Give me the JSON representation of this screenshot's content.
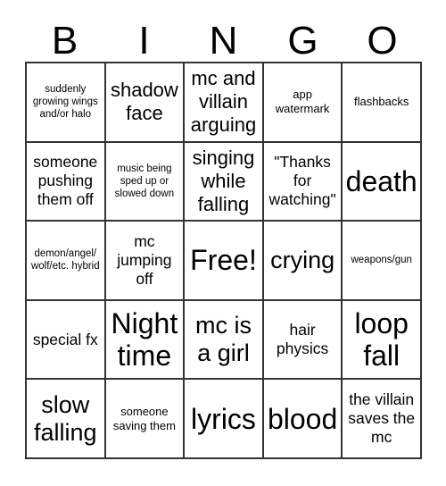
{
  "card": {
    "title": "BINGO",
    "header_letters": [
      "B",
      "I",
      "N",
      "G",
      "O"
    ],
    "grid_size": "5x5",
    "free_space_index": 12,
    "colors": {
      "background": "#ffffff",
      "text": "#000000",
      "grid_line": "#333333"
    },
    "cells": [
      {
        "text": "suddenly growing wings and/or halo",
        "size": "xs"
      },
      {
        "text": "shadow face",
        "size": "l"
      },
      {
        "text": "mc and villain arguing",
        "size": "l"
      },
      {
        "text": "app watermark",
        "size": "s"
      },
      {
        "text": "flashbacks",
        "size": "s"
      },
      {
        "text": "someone pushing them off",
        "size": "m"
      },
      {
        "text": "music being sped up or slowed down",
        "size": "xs"
      },
      {
        "text": "singing while falling",
        "size": "l"
      },
      {
        "text": "\"Thanks for watching\"",
        "size": "m"
      },
      {
        "text": "death",
        "size": "xxl"
      },
      {
        "text": "demon/angel/ wolf/etc. hybrid",
        "size": "xs"
      },
      {
        "text": "mc jumping off",
        "size": "m"
      },
      {
        "text": "Free!",
        "size": "xxl"
      },
      {
        "text": "crying",
        "size": "xl"
      },
      {
        "text": "weapons/gun",
        "size": "xs"
      },
      {
        "text": "special fx",
        "size": "m"
      },
      {
        "text": "Night time",
        "size": "xxl"
      },
      {
        "text": "mc is a girl",
        "size": "xl"
      },
      {
        "text": "hair physics",
        "size": "m"
      },
      {
        "text": "loop fall",
        "size": "xxl"
      },
      {
        "text": "slow falling",
        "size": "xl"
      },
      {
        "text": "someone saving them",
        "size": "s"
      },
      {
        "text": "lyrics",
        "size": "xxl"
      },
      {
        "text": "blood",
        "size": "xxl"
      },
      {
        "text": "the villain saves the mc",
        "size": "m"
      }
    ]
  }
}
